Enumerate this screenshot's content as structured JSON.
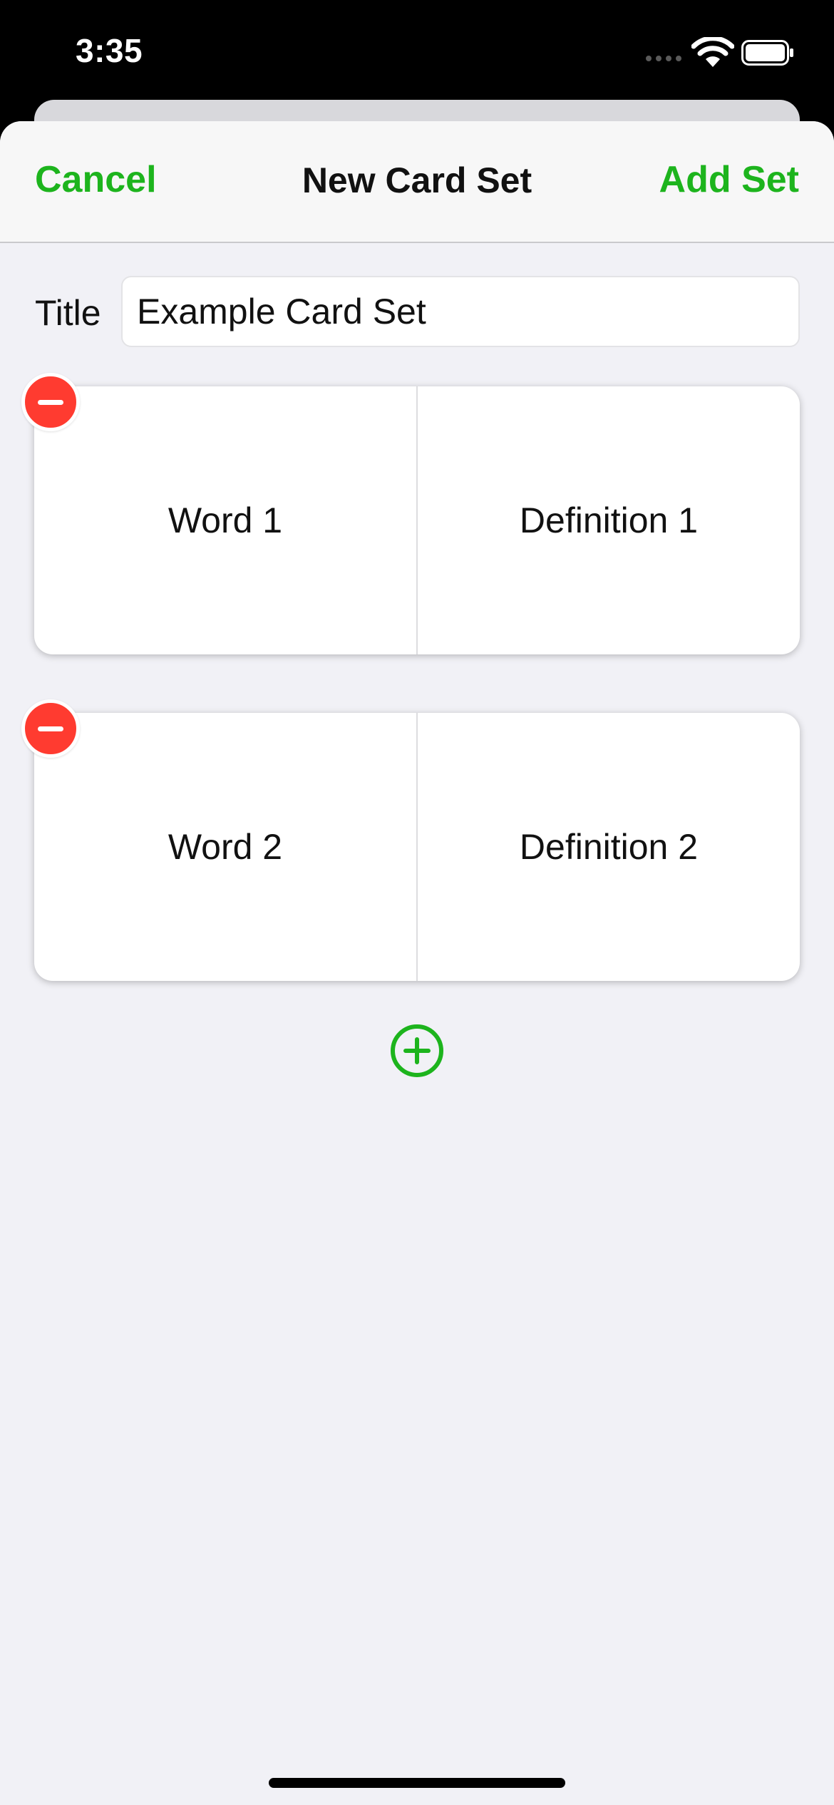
{
  "status_bar": {
    "time": "3:35"
  },
  "nav": {
    "cancel_label": "Cancel",
    "title": "New Card Set",
    "add_label": "Add Set"
  },
  "form": {
    "title_label": "Title",
    "title_value": "Example Card Set"
  },
  "cards": [
    {
      "word": "Word 1",
      "definition": "Definition 1"
    },
    {
      "word": "Word 2",
      "definition": "Definition 2"
    }
  ],
  "colors": {
    "accent": "#1db41d",
    "remove": "#ff3b30",
    "background": "#f1f1f6"
  },
  "icons": {
    "remove": "minus-circle-icon",
    "add": "plus-circle-icon",
    "wifi": "wifi-icon",
    "battery": "battery-icon"
  }
}
